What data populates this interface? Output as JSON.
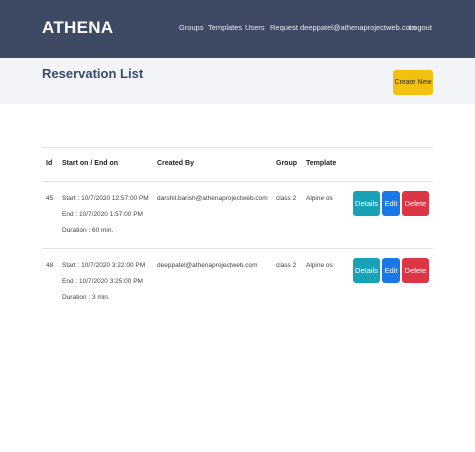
{
  "navbar": {
    "brand": "ATHENA",
    "links": [
      "Groups",
      "Templates",
      "Users",
      "Request",
      "deeppatel@athenaprojectweb.com",
      "Logout"
    ]
  },
  "page": {
    "title": "Reservation List",
    "create_label": "Create New"
  },
  "table": {
    "headers": [
      "Id",
      "Start on / End on",
      "Created By",
      "Group",
      "Template"
    ],
    "rows": [
      {
        "id": "45",
        "start": "Start : 10/7/2020 12:57:00 PM",
        "end": "End : 10/7/2020 1:57:00 PM",
        "duration": "Duration : 60 min.",
        "created_by": "darshil.barish@athenaprojectweb.com",
        "group": "class 2",
        "template": "Alpine os",
        "actions": [
          "Details",
          "Edit",
          "Delete"
        ]
      },
      {
        "id": "48",
        "start": "Start : 10/7/2020 3:22:00 PM",
        "end": "End : 10/7/2020 3:25:00 PM",
        "duration": "Duration : 3 min.",
        "created_by": "deeppatel@athenaprojectweb.com",
        "group": "class 2",
        "template": "Alpine os",
        "actions": [
          "Details",
          "Edit",
          "Delete"
        ]
      }
    ]
  },
  "colors": {
    "navbar": "#3e4a63",
    "create_button": "#f2c10f",
    "details_button": "#17a2b8",
    "edit_button": "#1a78e6",
    "delete_button": "#dc3545"
  }
}
